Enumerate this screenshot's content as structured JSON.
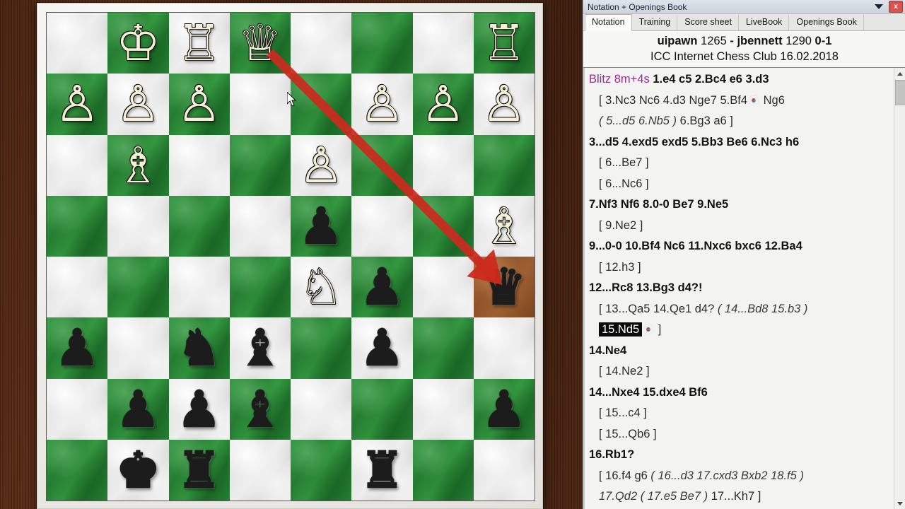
{
  "window": {
    "title": "Notation + Openings Book",
    "dropdown_icon": "chevron-down-icon",
    "close_label": "x"
  },
  "tabs": [
    {
      "label": "Notation",
      "active": true
    },
    {
      "label": "Training",
      "active": false
    },
    {
      "label": "Score sheet",
      "active": false
    },
    {
      "label": "LiveBook",
      "active": false
    },
    {
      "label": "Openings Book",
      "active": false
    }
  ],
  "game_header": {
    "white_name": "uipawn",
    "white_elo": "1265",
    "separator": "-",
    "black_name": "jbennett",
    "black_elo": "1290",
    "result": "0-1",
    "event": "ICC Internet Chess Club",
    "date": "16.02.2018"
  },
  "notation": {
    "time_control": "Blitz 8m+4s",
    "lines": [
      {
        "type": "main-with-opening",
        "opening": "Blitz 8m+4s",
        "text": "1.e4  c5  2.Bc4  e6  3.d3"
      },
      {
        "type": "var",
        "text": "[ 3.Nc3  Nc6  4.d3  Nge7  5.Bf4",
        "dot": true,
        "text_after": "Ng6"
      },
      {
        "type": "var-italic",
        "italic": "( 5...d5  6.Nb5 )",
        "text_after": "6.Bg3  a6 ]"
      },
      {
        "type": "main",
        "text": "3...d5  4.exd5  exd5  5.Bb3  Be6  6.Nc3  h6"
      },
      {
        "type": "var",
        "text": "[ 6...Be7 ]"
      },
      {
        "type": "var",
        "text": "[ 6...Nc6 ]"
      },
      {
        "type": "main",
        "text": "7.Nf3  Nf6  8.0-0  Be7  9.Ne5"
      },
      {
        "type": "var",
        "text": "[ 9.Ne2 ]"
      },
      {
        "type": "main",
        "text": "9...0-0  10.Bf4  Nc6  11.Nxc6  bxc6  12.Ba4"
      },
      {
        "type": "var",
        "text": "[ 12.h3 ]"
      },
      {
        "type": "main",
        "text": "12...Rc8  13.Bg3  d4?!"
      },
      {
        "type": "var-mixed",
        "text": "[ 13...Qa5  14.Qe1  d4?",
        "italic": "( 14...Bd8  15.b3 )"
      },
      {
        "type": "var-highlight",
        "highlight": "15.Nd5",
        "dot": true,
        "text_after": "]"
      },
      {
        "type": "main",
        "text": "14.Ne4"
      },
      {
        "type": "var",
        "text": "[ 14.Ne2 ]"
      },
      {
        "type": "main",
        "text": "14...Nxe4  15.dxe4  Bf6"
      },
      {
        "type": "var",
        "text": "[ 15...c4 ]"
      },
      {
        "type": "var",
        "text": "[ 15...Qb6 ]"
      },
      {
        "type": "main",
        "text": "16.Rb1?"
      },
      {
        "type": "var-mixed",
        "text": "[ 16.f4  g6",
        "italic": "( 16...d3  17.cxd3  Bxb2  18.f5 )"
      },
      {
        "type": "var-mixed2",
        "italic": "17.Qd2  ( 17.e5  Be7 )",
        "text_after": "17...Kh7 ]"
      }
    ]
  },
  "board": {
    "highlight_square": "h4",
    "arrow": {
      "from": "d8",
      "to": "h4",
      "color": "#cc2a1e"
    },
    "cursor_position": "e7",
    "light_color": "#e8e8e8",
    "dark_color": "#2a8a38",
    "highlight_color": "#9c5e31",
    "ranks": [
      [
        "",
        "wK",
        "wR",
        "wQ",
        "",
        "",
        "",
        "wR"
      ],
      [
        "wP",
        "wP",
        "wP",
        "",
        "",
        "wP",
        "wP",
        "wP"
      ],
      [
        "",
        "wB",
        "",
        "",
        "wP",
        "",
        "",
        ""
      ],
      [
        "",
        "",
        "",
        "",
        "bP",
        "",
        "",
        "wB"
      ],
      [
        "",
        "",
        "",
        "",
        "wN",
        "bP",
        "",
        "bQ"
      ],
      [
        "bP",
        "",
        "bN",
        "bB",
        "",
        "bP",
        "",
        ""
      ],
      [
        "",
        "bP",
        "bP",
        "bB",
        "",
        "",
        "",
        "bP"
      ],
      [
        "",
        "bK",
        "bR",
        "",
        "",
        "bR",
        "",
        ""
      ]
    ],
    "glyphs": {
      "wK": "♔",
      "wQ": "♕",
      "wR": "♖",
      "wB": "♗",
      "wN": "♘",
      "wP": "♙",
      "bK": "♚",
      "bQ": "♛",
      "bR": "♜",
      "bB": "♝",
      "bN": "♞",
      "bP": "♟"
    }
  }
}
